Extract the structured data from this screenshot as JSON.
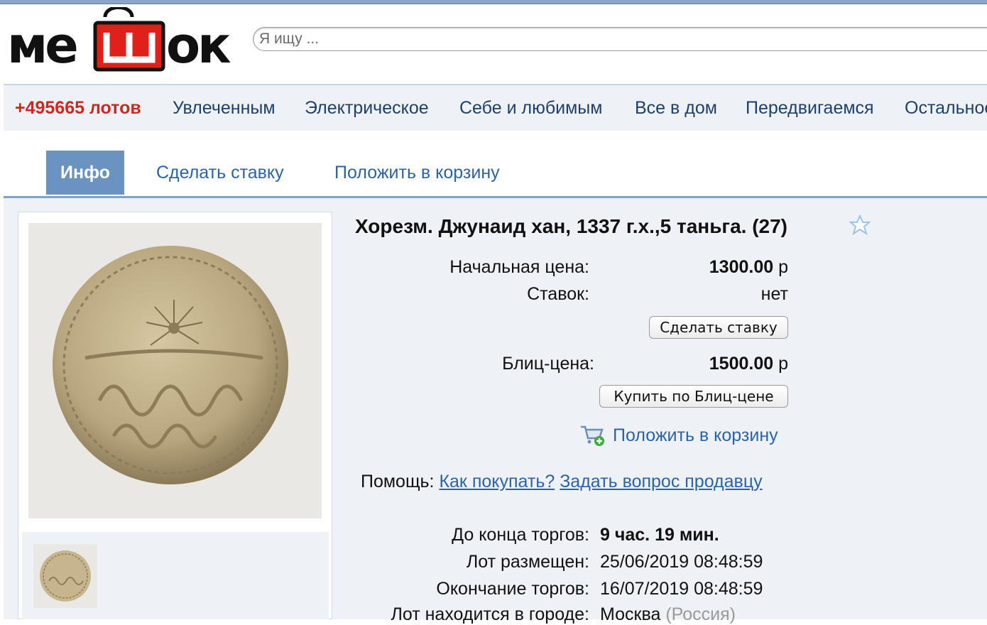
{
  "brand": {
    "logo_text": "мешок"
  },
  "search": {
    "placeholder": "Я ищу ..."
  },
  "categories": {
    "lots": "+495665 лотов",
    "items": [
      "Увлеченным",
      "Электрическое",
      "Себе и любимым",
      "Все в дом",
      "Передвигаемся",
      "Остальное"
    ]
  },
  "tabs": [
    "Инфо",
    "Сделать ставку",
    "Положить в корзину"
  ],
  "lot": {
    "title": "Хорезм. Джунаид хан, 1337 г.х.,5 таньга. (27)",
    "start_price_label": "Начальная цена:",
    "start_price": "1300.00",
    "bids_label": "Ставок:",
    "bids_value": "нет",
    "bid_button": "Сделать ставку",
    "blitz_label": "Блиц-цена:",
    "blitz_price": "1500.00",
    "currency": "р",
    "blitz_button": "Купить по Блиц-цене",
    "cart_link": "Положить в корзину",
    "help_label": "Помощь:",
    "help_how": "Как покупать?",
    "help_ask": "Задать вопрос продавцу",
    "ends_in_label": "До конца торгов:",
    "ends_in": "9 час. 19 мин.",
    "posted_label": "Лот размещен:",
    "posted": "25/06/2019 08:48:59",
    "end_label": "Окончание торгов:",
    "end": "16/07/2019 08:48:59",
    "city_label": "Лот находится в городе:",
    "city": "Москва",
    "country": "(Россия)"
  },
  "colors": {
    "brand_red": "#e0211b",
    "link_blue": "#2b63a6",
    "tab_active": "#6b93c2",
    "lots_red": "#d0281f"
  },
  "icons": [
    "shopping-bag-logo-icon",
    "favorite-star-icon",
    "cart-add-icon"
  ]
}
